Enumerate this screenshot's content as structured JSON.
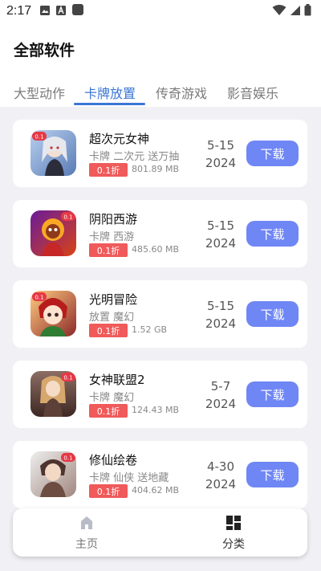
{
  "status_bar": {
    "time": "2:17",
    "icons": [
      "image-icon",
      "text-a-icon",
      "app-icon",
      "wifi-icon",
      "signal-icon",
      "battery-icon"
    ]
  },
  "page": {
    "title": "全部软件"
  },
  "tabs": [
    {
      "label": "大型动作",
      "active": false
    },
    {
      "label": "卡牌放置",
      "active": true
    },
    {
      "label": "传奇游戏",
      "active": false
    },
    {
      "label": "影音娱乐",
      "active": false
    }
  ],
  "apps": [
    {
      "name": "超次元女神",
      "tags": "卡牌 二次元 送万抽",
      "discount": "0.1折",
      "size": "801.89 MB",
      "date_line1": "5-15",
      "date_line2": "2024",
      "button": "下载"
    },
    {
      "name": "阴阳西游",
      "tags": "卡牌 西游",
      "discount": "0.1折",
      "size": "485.60 MB",
      "date_line1": "5-15",
      "date_line2": "2024",
      "button": "下载"
    },
    {
      "name": "光明冒险",
      "tags": "放置 魔幻",
      "discount": "0.1折",
      "size": "1.52 GB",
      "date_line1": "5-15",
      "date_line2": "2024",
      "button": "下载"
    },
    {
      "name": "女神联盟2",
      "tags": "卡牌 魔幻",
      "discount": "0.1折",
      "size": "124.43 MB",
      "date_line1": "5-7",
      "date_line2": "2024",
      "button": "下载"
    },
    {
      "name": "修仙绘卷",
      "tags": "卡牌 仙侠 送地藏",
      "discount": "0.1折",
      "size": "404.62 MB",
      "date_line1": "4-30",
      "date_line2": "2024",
      "button": "下载"
    }
  ],
  "bottom_nav": [
    {
      "label": "主页",
      "icon": "home-icon",
      "active": false
    },
    {
      "label": "分类",
      "icon": "category-icon",
      "active": true
    }
  ],
  "colors": {
    "accent": "#3a76d6",
    "button": "#6f86f5",
    "discount": "#f05a5a",
    "list_background": "#f1f1f5"
  }
}
